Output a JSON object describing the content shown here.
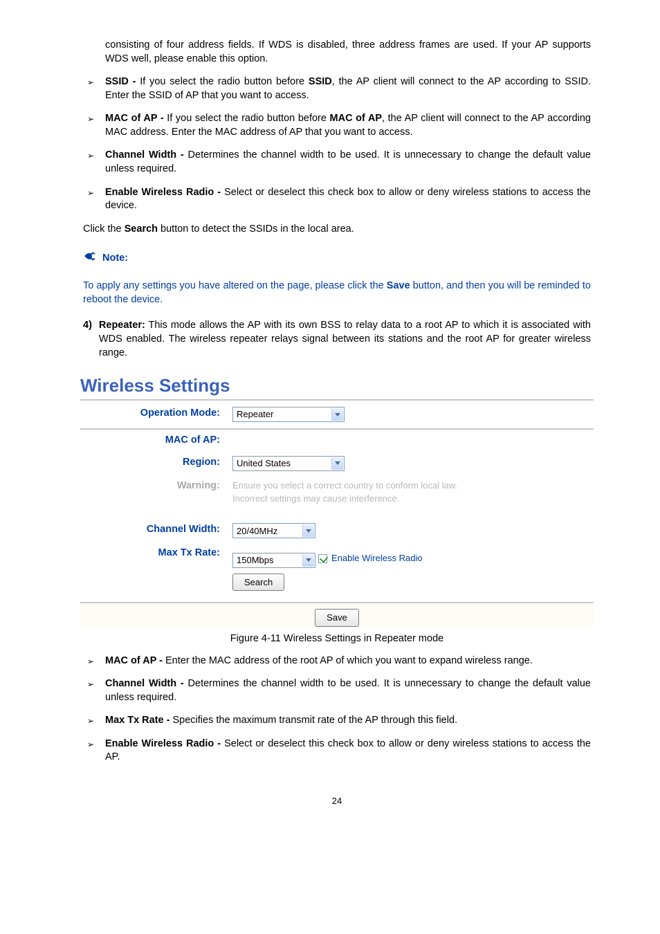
{
  "intro": {
    "p1": "consisting of four address fields. If WDS is disabled, three address frames are used. If your AP supports WDS well, please enable this option."
  },
  "top_bullets": [
    {
      "lead": "SSID - ",
      "body_pre": "If you select the radio button before ",
      "bold_mid": "SSID",
      "body_post": ", the AP client will connect to the AP according to SSID. Enter the SSID of AP that you want to access."
    },
    {
      "lead": "MAC of AP - ",
      "body_pre": "If you select the radio button before ",
      "bold_mid": "MAC of AP",
      "body_post": ", the AP client will connect to the AP according MAC address. Enter the MAC address of AP that you want to access."
    },
    {
      "lead": "Channel Width - ",
      "body_pre": "Determines the channel width to be used. It is unnecessary to change the default value unless required.",
      "bold_mid": "",
      "body_post": ""
    },
    {
      "lead": "Enable Wireless Radio - ",
      "body_pre": "Select or deselect this check box to allow or deny wireless stations to access the device.",
      "bold_mid": "",
      "body_post": ""
    }
  ],
  "click_search": {
    "pre": "Click the ",
    "bold": "Search",
    "post": " button to detect the SSIDs in the local area."
  },
  "note": {
    "label": "Note:",
    "text_pre": "To apply any settings you have altered on the page, please click the ",
    "bold": "Save",
    "text_post": " button, and then you will be reminded to reboot the device."
  },
  "step4": {
    "num": "4)",
    "lead": "Repeater:",
    "body": "This mode allows the AP with its own BSS to relay data to a root AP to which it is associated with WDS enabled. The wireless repeater relays signal between its stations and the root AP for greater wireless range."
  },
  "panel": {
    "title": "Wireless Settings",
    "labels": {
      "operation_mode": "Operation Mode:",
      "mac_of_ap": "MAC of AP:",
      "region": "Region:",
      "warning": "Warning:",
      "channel_width": "Channel Width:",
      "max_tx_rate": "Max Tx Rate:"
    },
    "values": {
      "operation_mode": "Repeater",
      "region": "United States",
      "warning_line1": "Ensure you select a correct country to conform local law.",
      "warning_line2": "Incorrect settings may cause interference.",
      "channel_width": "20/40MHz",
      "max_tx_rate": "150Mbps",
      "checkbox_label": "Enable Wireless Radio",
      "search_btn": "Search",
      "save_btn": "Save"
    }
  },
  "figure_caption": "Figure 4-11 Wireless Settings in Repeater mode",
  "bottom_bullets": [
    {
      "lead": "MAC of AP - ",
      "body": "Enter the MAC address of the root AP of which you want to expand wireless range."
    },
    {
      "lead": "Channel Width - ",
      "body": "Determines the channel width to be used. It is unnecessary to change the default value unless required."
    },
    {
      "lead": "Max Tx Rate - ",
      "body": "Specifies the maximum transmit rate of the AP through this field."
    },
    {
      "lead": "Enable Wireless Radio - ",
      "body": "Select or deselect this check box to allow or deny wireless stations to access the AP."
    }
  ],
  "page_number": "24"
}
